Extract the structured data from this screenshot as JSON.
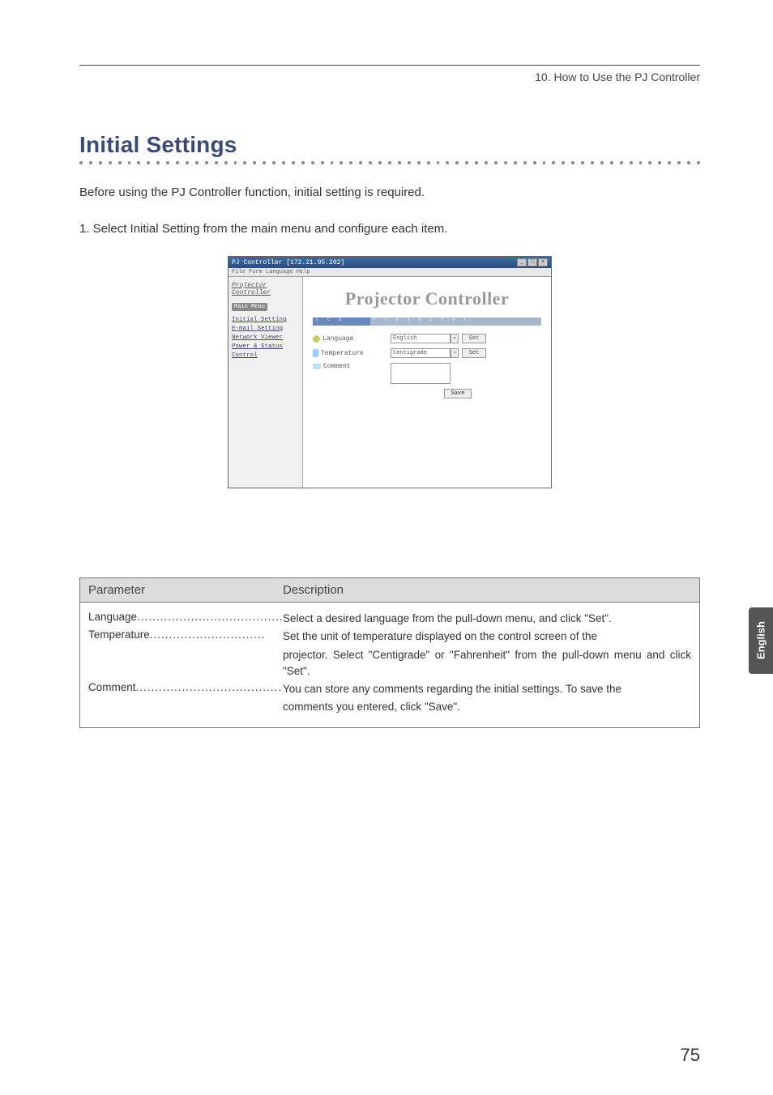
{
  "header": {
    "chapter": "10. How to Use the PJ Controller"
  },
  "title": "Initial Settings",
  "paragraphs": {
    "p1": "Before using the PJ Controller function, initial setting is required.",
    "p2": "1. Select Initial Setting from the main menu and configure each item."
  },
  "screenshot": {
    "titlebar": "PJ Controller  [172.21.95.202]",
    "menubar": "File  Form  Language  Help",
    "side_logo": "Projector Controller",
    "main_menu_badge": "Main Menu",
    "links": {
      "initial": "Initial Setting",
      "email": "E-mail Setting",
      "network": "Network Viewer",
      "power": "Power & Status",
      "control": "Control"
    },
    "big_title": "Projector Controller",
    "bar_left": "L C D",
    "bar_right": "P r o j e c t o r",
    "rows": {
      "language_label": "Language",
      "language_value": "English",
      "language_set": "Set",
      "temperature_label": "Temperature",
      "temperature_value": "Centigrade",
      "temperature_set": "Set",
      "comment_label": "Comment",
      "save": "Save"
    }
  },
  "table": {
    "headers": {
      "param": "Parameter",
      "desc": "Description"
    },
    "rows": {
      "language": {
        "name": "Language",
        "dots": "......................................",
        "desc": "Select a desired language from the pull-down menu, and click \"Set\"."
      },
      "temperature": {
        "name": "Temperature",
        "dots": "..............................",
        "desc_l1": "Set the unit of temperature displayed on the control screen of the",
        "desc_l2": "projector.  Select \"Centigrade\" or \"Fahrenheit\" from the pull-down menu and click \"Set\"."
      },
      "comment": {
        "name": "Comment",
        "dots": "......................................",
        "desc_l1": "You can store any comments regarding the initial settings.  To save the",
        "desc_l2": "comments you entered, click \"Save\"."
      }
    }
  },
  "side_tab": "English",
  "page_number": "75"
}
